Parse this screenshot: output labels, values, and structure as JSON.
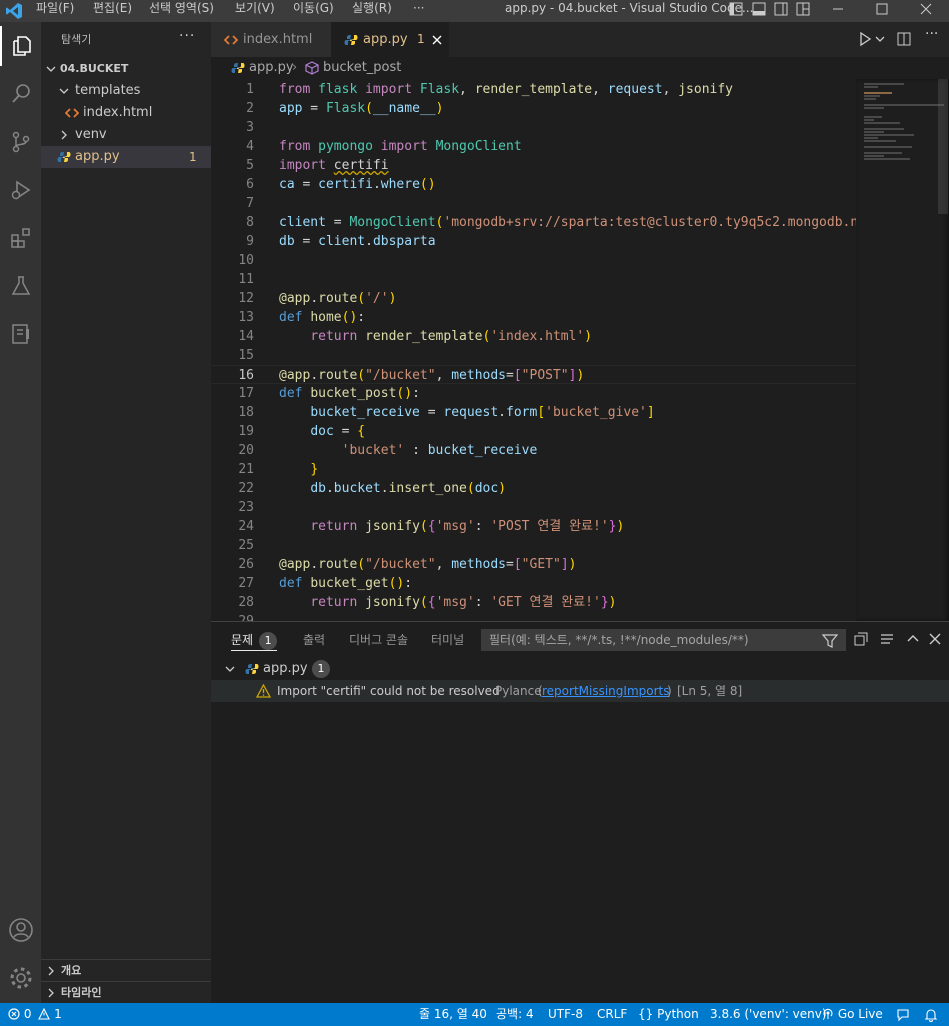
{
  "window": {
    "title": "app.py - 04.bucket - Visual Studio Code...",
    "menu": [
      "파일(F)",
      "편집(E)",
      "선택 영역(S)",
      "보기(V)",
      "이동(G)",
      "실행(R)",
      "···"
    ]
  },
  "sidebar": {
    "header": "탐색기",
    "more": "···",
    "root": "04.BUCKET",
    "items": [
      {
        "label": "templates",
        "type": "folder-open"
      },
      {
        "label": "index.html",
        "type": "html-file"
      },
      {
        "label": "venv",
        "type": "folder-closed"
      },
      {
        "label": "app.py",
        "type": "python-file",
        "badge": "1"
      }
    ],
    "outline": "개요",
    "timeline": "타임라인"
  },
  "tabs": [
    {
      "label": "index.html",
      "icon": "html-icon"
    },
    {
      "label": "app.py",
      "icon": "python-icon",
      "badge": "1"
    }
  ],
  "breadcrumb": {
    "file": "app.py",
    "symbol": "bucket_post"
  },
  "editor": {
    "current_line": 16,
    "line_numbers": [
      "1",
      "2",
      "3",
      "4",
      "5",
      "6",
      "7",
      "8",
      "9",
      "10",
      "11",
      "12",
      "13",
      "14",
      "15",
      "16",
      "17",
      "18",
      "19",
      "20",
      "21",
      "22",
      "23",
      "24",
      "25",
      "26",
      "27",
      "28",
      "29"
    ]
  },
  "panel": {
    "tabs": [
      {
        "label": "문제",
        "badge": "1"
      },
      {
        "label": "출력"
      },
      {
        "label": "디버그 콘솔"
      },
      {
        "label": "터미널"
      }
    ],
    "filter_placeholder": "필터(예: 텍스트, **/*.ts, !**/node_modules/**)",
    "problem_file": {
      "name": "app.py",
      "count": "1"
    },
    "problem": {
      "message": "Import \"certifi\" could not be resolved",
      "source": "Pylance",
      "code": "reportMissingImports",
      "location": "[Ln 5, 열 8]"
    }
  },
  "statusbar": {
    "errors": "0",
    "warnings": "1",
    "position": "줄 16, 열 40",
    "spaces": "공백: 4",
    "encoding": "UTF-8",
    "eol": "CRLF",
    "language": "Python",
    "interpreter": "3.8.6 ('venv': venv)",
    "golive": "Go Live"
  },
  "colors": {
    "accent": "#007acc",
    "warning": "#cca700",
    "modified": "#e2c08d"
  }
}
